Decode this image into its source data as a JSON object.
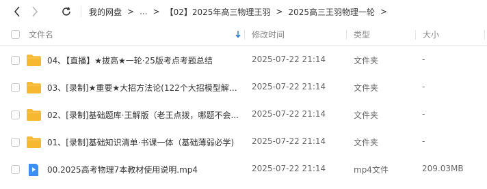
{
  "toolbar": {
    "back_icon": "chevron-left-icon",
    "forward_icon": "chevron-right-icon",
    "refresh_icon": "refresh-icon"
  },
  "breadcrumb": {
    "items": [
      "我的网盘",
      "...",
      "【02】2025年高三物理王羽",
      "2025高三王羽物理一轮"
    ],
    "separator": ">"
  },
  "table": {
    "headers": {
      "name": "文件名",
      "mtime": "修改时间",
      "type": "类型",
      "size": "大小"
    },
    "sort_icon": "arrow-down-icon",
    "rows": [
      {
        "name": "04、【直播】★拔高★一轮·25版考点考题总结",
        "mtime": "2025-07-22 21:14",
        "type": "文件夹",
        "size": "-",
        "icon": "folder-icon"
      },
      {
        "name": "03、[录制]★重要★大招方法论(122个大招模型解题...",
        "mtime": "2025-07-22 21:14",
        "type": "文件夹",
        "size": "-",
        "icon": "folder-icon"
      },
      {
        "name": "02、[录制]基础题库·王解版（老王点拨，哪题不会...",
        "mtime": "2025-07-22 21:14",
        "type": "文件夹",
        "size": "-",
        "icon": "folder-icon"
      },
      {
        "name": "01、[录制]基础知识清单·书课一体（基础薄弱必学)",
        "mtime": "2025-07-22 21:14",
        "type": "文件夹",
        "size": "-",
        "icon": "folder-icon"
      },
      {
        "name": "00.2025高考物理7本教材使用说明.mp4",
        "mtime": "2025-07-22 21:14",
        "type": "mp4文件",
        "size": "209.03MB",
        "icon": "video-file-icon"
      }
    ]
  },
  "colors": {
    "folder": "#f5b82e",
    "video": "#3a8ef6",
    "header_text": "#888888",
    "sort_arrow": "#1a73e8"
  }
}
